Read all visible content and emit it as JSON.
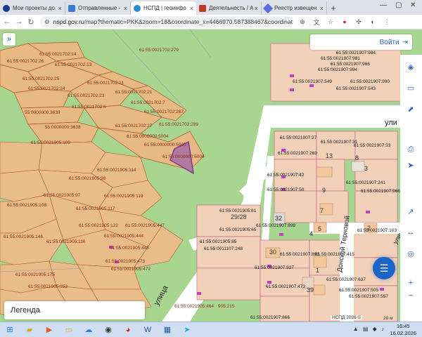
{
  "browser": {
    "tabs": [
      {
        "label": "Мои проекты до",
        "color": "#1a3a8a",
        "active": false
      },
      {
        "label": "Отправленные -",
        "color": "#3a7bd5",
        "active": false
      },
      {
        "label": "НСПД | геоинфо",
        "color": "#2a8fd0",
        "active": true
      },
      {
        "label": "Деятельность / А",
        "color": "#c0392b",
        "active": false
      },
      {
        "label": "Реестр извещен",
        "color": "#5a6fd8",
        "active": false
      }
    ],
    "new_tab": "+",
    "url_host": "nspd.gov.ru",
    "url_rest": "/map?thematic=PKK&zoom=18&coordinate_x=4466970.587388467&coordinat..."
  },
  "map": {
    "login_label": "Войти",
    "legend_label": "Легенда",
    "copyright": "НСПД 2026 ©",
    "scale": "20 м",
    "parcel_labels": [
      "61:55:0021702:279",
      "61:55:0021702:14",
      "61:55:0021702:26",
      "61:55:0021702:13",
      "61:55:0021702:25",
      "61:55:0021702:24",
      "61:55:0021702:11",
      "61:55:0021702:23",
      "61:55:0021702:21",
      "61:55:0021702:6",
      "61:55:0021702:7",
      "61:55:0021702:287",
      "55:0000000:3639",
      "61:55:0021702:27",
      "61:55:0021702:289",
      "55:0000000:3638",
      "61:55:0000000:5004",
      "61:55:0000000:5005",
      "61:55:0000000:5006",
      "61:55:0021905:109",
      "61:55:0021905:114",
      "61:55:0021905:98",
      "61:55:0021905:119",
      "61:55:0021905:97",
      "61:55:0021905:117",
      "61:55:0021905:108",
      "61:55:0021905:122",
      "61:55:0021905:447",
      "61:55:0021905:444",
      "61:55:0021905:445",
      "61:55:0021905:473",
      "61:55:0021905:472",
      "61:55:0021905:175",
      "61:55:0021905:153",
      "61:55:0021905:146",
      "61:55:0021905:116",
      "61:55:0021905:464",
      "905:215",
      "61:55:0021907:984",
      "61:55:0021907:981",
      "61:55:0021907:966",
      "61:55:0021907:994",
      "61:55:0021907:549",
      "61:55:0021907:990",
      "61:55:0021907:543",
      "61:55:0021907:27",
      "61:55:0021907:31",
      "61:55:0021907:269",
      "61:55:0021907:42",
      "61:55:0021907:241",
      "61:55:0021907:50",
      "61:55:0021907:33",
      "61:55:0021907:966",
      "61:55:0021907:103",
      "61:55:0021907:899",
      "61:55:0021907:893",
      "61:55:0021907:415",
      "61:55:0021907:927",
      "61:55:0021907:473",
      "61:55:0021907:637",
      "61:55:0021907:557",
      "61:55:0021907:505",
      "61:55:0021907:866",
      "61:55:0011107:248",
      "61:55:0021905:85",
      "61:55:0021905:61",
      "61:55:0021905:65"
    ],
    "building_numbers": [
      "32",
      "30",
      "13",
      "8",
      "9",
      "7",
      "5",
      "4",
      "2",
      "1",
      "3",
      "39",
      "29/28"
    ],
    "street_labels": [
      "улица",
      "ули",
      "Донской Терновой",
      "улица"
    ],
    "colors": {
      "green": "#a8d690",
      "parcel_fill": "#e8b880",
      "parcel_border": "#b0552a",
      "building": "#f3c79a",
      "road": "#ffffff",
      "accent": "#3162c7",
      "highlight": "#7a3a8a"
    },
    "side_tools": [
      "layers-icon",
      "print-icon",
      "ruler-icon",
      "measure-icon",
      "navigate-icon",
      "locate-icon",
      "zoom-in-icon",
      "zoom-out-icon",
      "chat-icon"
    ]
  },
  "taskbar": {
    "time": "16:45",
    "date": "16.02.2026"
  }
}
